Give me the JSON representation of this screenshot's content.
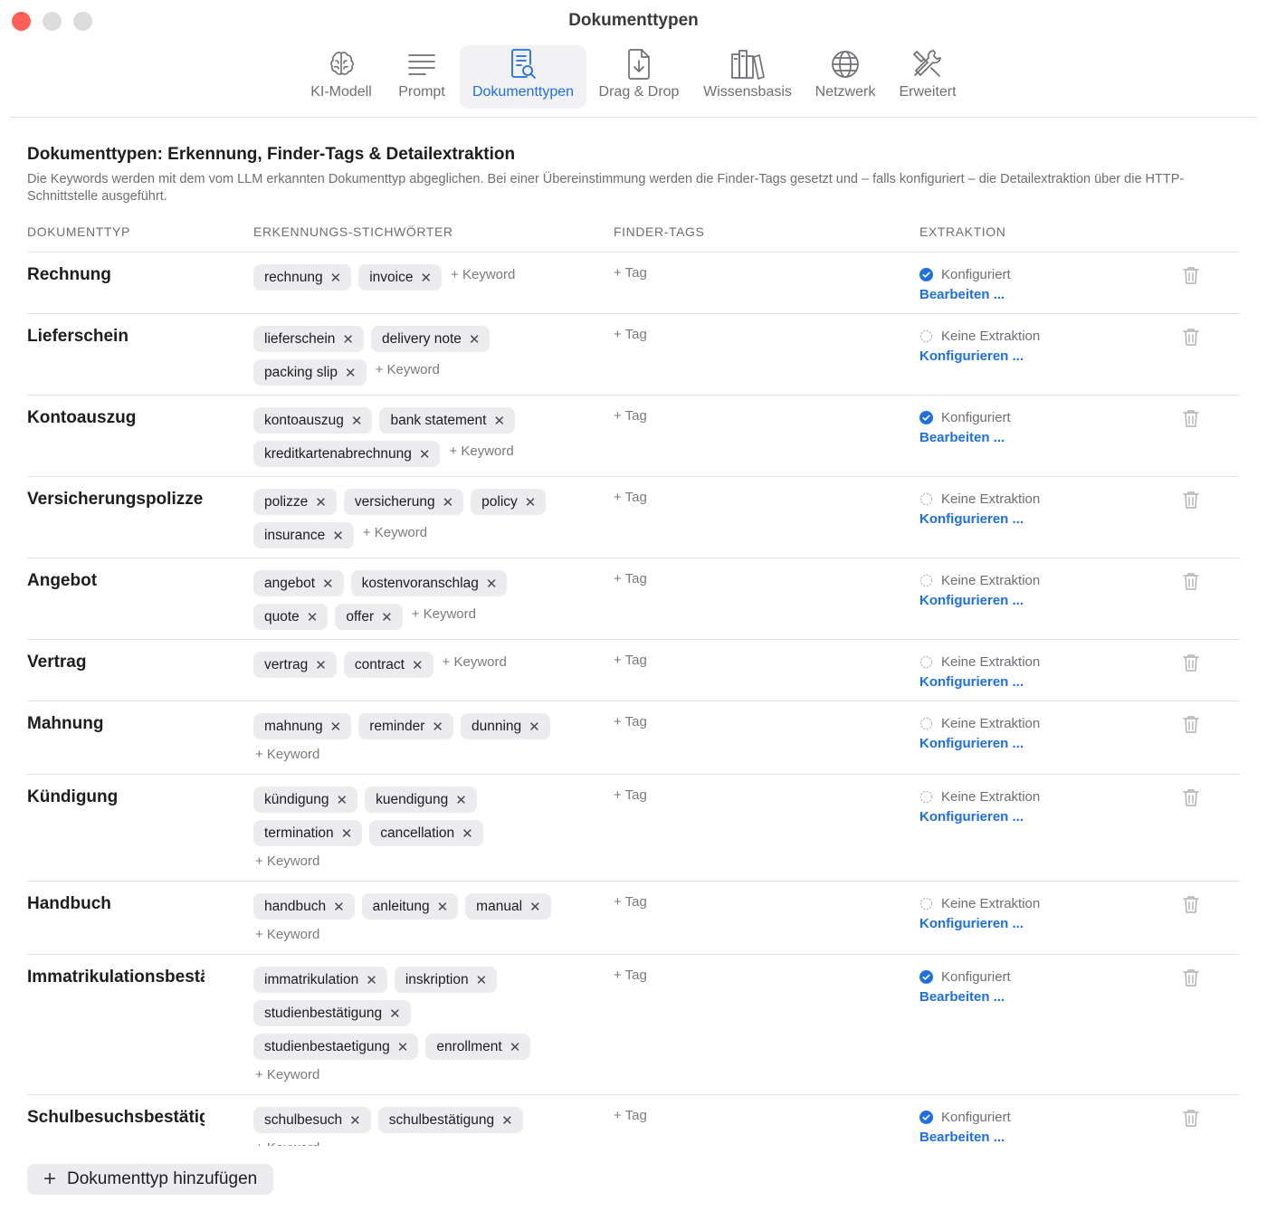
{
  "window": {
    "title": "Dokumenttypen"
  },
  "toolbar": {
    "items": [
      {
        "label": "KI-Modell",
        "icon": "brain-icon"
      },
      {
        "label": "Prompt",
        "icon": "text-lines-icon"
      },
      {
        "label": "Dokumenttypen",
        "icon": "document-search-icon",
        "active": true
      },
      {
        "label": "Drag & Drop",
        "icon": "document-download-icon"
      },
      {
        "label": "Wissensbasis",
        "icon": "books-icon"
      },
      {
        "label": "Netzwerk",
        "icon": "globe-icon"
      },
      {
        "label": "Erweitert",
        "icon": "tools-icon"
      }
    ]
  },
  "page": {
    "heading": "Dokumenttypen: Erkennung, Finder-Tags & Detailextraktion",
    "description": "Die Keywords werden mit dem vom LLM erkannten Dokumenttyp abgeglichen. Bei einer Übereinstimmung werden die Finder-Tags gesetzt und – falls konfiguriert – die Detailextraktion über die HTTP-Schnittstelle ausgeführt."
  },
  "columns": {
    "type": "DOKUMENTTYP",
    "keywords": "ERKENNUNGS-STICHWÖRTER",
    "tags": "FINDER-TAGS",
    "extraction": "EXTRAKTION"
  },
  "labels": {
    "add_keyword": "+ Keyword",
    "add_tag": "+ Tag",
    "configured": "Konfiguriert",
    "edit": "Bearbeiten ...",
    "no_extraction": "Keine Extraktion",
    "configure": "Konfigurieren ...",
    "add_doctype": "Dokumenttyp hinzufügen"
  },
  "colors": {
    "accent": "#1f6fe0",
    "chip_bg": "#ececee",
    "close": "#ff5f57"
  },
  "doctypes": [
    {
      "name": "Rechnung",
      "keywords": [
        "rechnung",
        "invoice"
      ],
      "configured": true
    },
    {
      "name": "Lieferschein",
      "keywords": [
        "lieferschein",
        "delivery note",
        "packing slip"
      ],
      "configured": false
    },
    {
      "name": "Kontoauszug",
      "keywords": [
        "kontoauszug",
        "bank statement",
        "kreditkartenabrechnung"
      ],
      "configured": true
    },
    {
      "name": "Versicherungspolizze",
      "keywords": [
        "polizze",
        "versicherung",
        "policy",
        "insurance"
      ],
      "configured": false
    },
    {
      "name": "Angebot",
      "keywords": [
        "angebot",
        "kostenvoranschlag",
        "quote",
        "offer"
      ],
      "configured": false
    },
    {
      "name": "Vertrag",
      "keywords": [
        "vertrag",
        "contract"
      ],
      "configured": false
    },
    {
      "name": "Mahnung",
      "keywords": [
        "mahnung",
        "reminder",
        "dunning"
      ],
      "configured": false
    },
    {
      "name": "Kündigung",
      "keywords": [
        "kündigung",
        "kuendigung",
        "termination",
        "cancellation"
      ],
      "configured": false
    },
    {
      "name": "Handbuch",
      "keywords": [
        "handbuch",
        "anleitung",
        "manual"
      ],
      "configured": false
    },
    {
      "name": "Immatrikulationsbestätigung",
      "keywords": [
        "immatrikulation",
        "inskription",
        "studienbestätigung",
        "studienbestaetigung",
        "enrollment"
      ],
      "configured": true
    },
    {
      "name": "Schulbesuchsbestätigung",
      "keywords": [
        "schulbesuch",
        "schulbestätigung"
      ],
      "configured": true
    }
  ]
}
